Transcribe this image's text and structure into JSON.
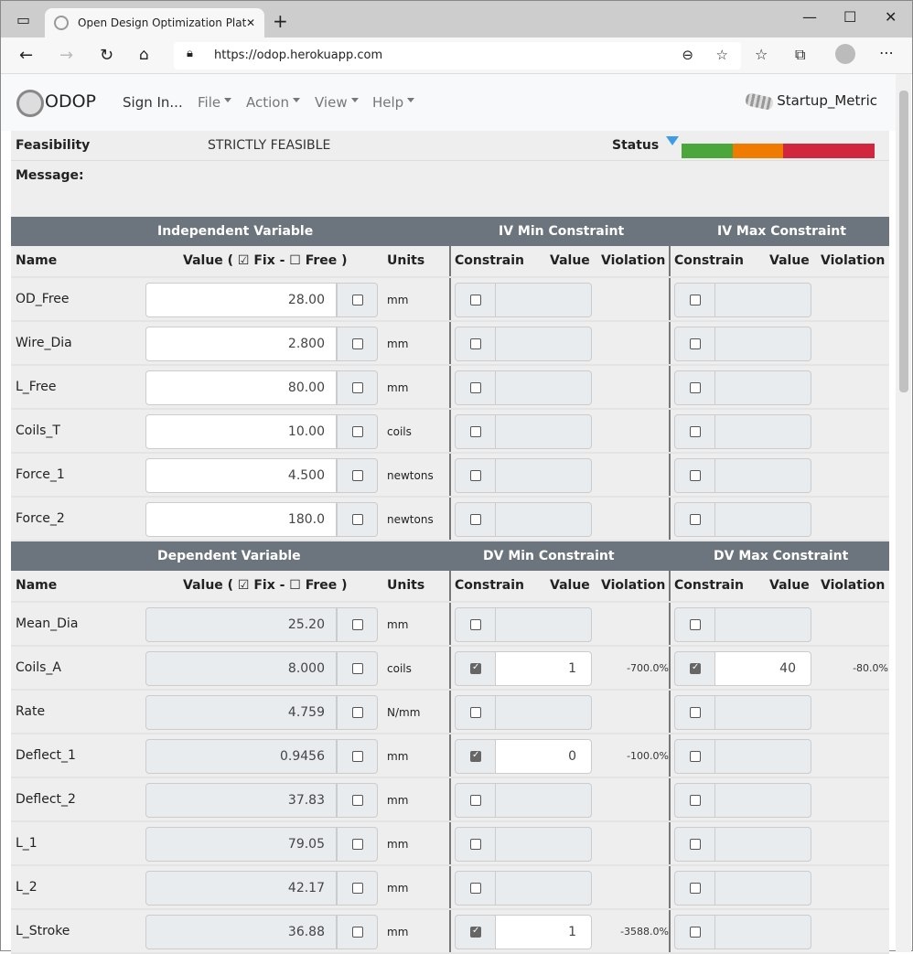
{
  "browser": {
    "tab_title": "Open Design Optimization Platform",
    "url": "https://odop.herokuapp.com"
  },
  "nav": {
    "brand": "ODOP",
    "items": [
      {
        "label": "Sign In...",
        "dropdown": false
      },
      {
        "label": "File",
        "dropdown": true
      },
      {
        "label": "Action",
        "dropdown": true
      },
      {
        "label": "View",
        "dropdown": true
      },
      {
        "label": "Help",
        "dropdown": true
      }
    ],
    "design": "Startup_Metric"
  },
  "status": {
    "feasibility_label": "Feasibility",
    "feasibility_value": "STRICTLY FEASIBLE",
    "message_label": "Message:",
    "status_label": "Status",
    "bar_colors": [
      "#4ba63b",
      "#ef7b00",
      "#d0273f"
    ],
    "indicator_position": 0
  },
  "iv": {
    "header": "Independent Variable",
    "min_header": "IV Min Constraint",
    "max_header": "IV Max Constraint",
    "rows": [
      {
        "name": "OD_Free",
        "value": "28.00",
        "units": "mm"
      },
      {
        "name": "Wire_Dia",
        "value": "2.800",
        "units": "mm"
      },
      {
        "name": "L_Free",
        "value": "80.00",
        "units": "mm"
      },
      {
        "name": "Coils_T",
        "value": "10.00",
        "units": "coils"
      },
      {
        "name": "Force_1",
        "value": "4.500",
        "units": "newtons"
      },
      {
        "name": "Force_2",
        "value": "180.0",
        "units": "newtons"
      }
    ]
  },
  "dv": {
    "header": "Dependent Variable",
    "min_header": "DV Min Constraint",
    "max_header": "DV Max Constraint",
    "rows": [
      {
        "name": "Mean_Dia",
        "value": "25.20",
        "units": "mm"
      },
      {
        "name": "Coils_A",
        "value": "8.000",
        "units": "coils",
        "min": {
          "on": true,
          "value": "1",
          "violation": "-700.0%"
        },
        "max": {
          "on": true,
          "value": "40",
          "violation": "-80.0%"
        }
      },
      {
        "name": "Rate",
        "value": "4.759",
        "units": "N/mm"
      },
      {
        "name": "Deflect_1",
        "value": "0.9456",
        "units": "mm",
        "min": {
          "on": true,
          "value": "0",
          "violation": "-100.0%"
        }
      },
      {
        "name": "Deflect_2",
        "value": "37.83",
        "units": "mm"
      },
      {
        "name": "L_1",
        "value": "79.05",
        "units": "mm"
      },
      {
        "name": "L_2",
        "value": "42.17",
        "units": "mm"
      },
      {
        "name": "L_Stroke",
        "value": "36.88",
        "units": "mm",
        "min": {
          "on": true,
          "value": "1",
          "violation": "-3588.0%"
        }
      }
    ]
  },
  "columns": {
    "name": "Name",
    "value": "Value ( ☑ Fix - ☐ Free )",
    "units": "Units",
    "constrain": "Constrain",
    "cvalue": "Value",
    "violation": "Violation"
  }
}
